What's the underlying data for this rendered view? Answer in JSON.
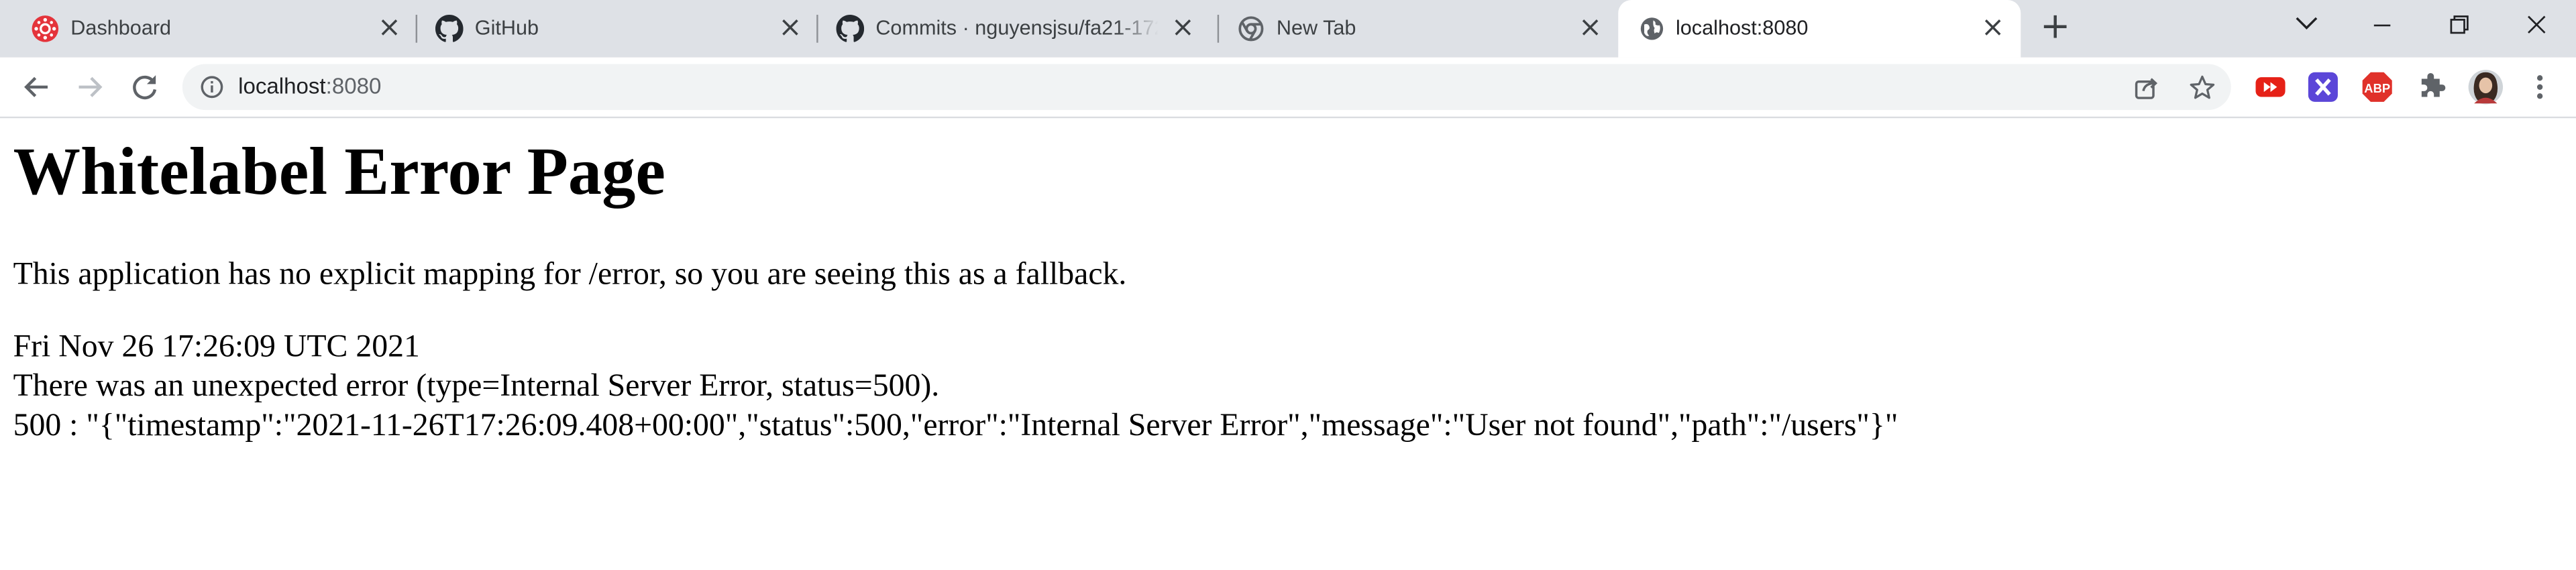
{
  "browser": {
    "tabs": [
      {
        "title": "Dashboard",
        "icon": "canvas-icon",
        "active": false
      },
      {
        "title": "GitHub",
        "icon": "github-icon",
        "active": false
      },
      {
        "title": "Commits · nguyensjsu/fa21-172-",
        "icon": "github-icon",
        "active": false
      },
      {
        "title": "New Tab",
        "icon": "chrome-icon",
        "active": false
      },
      {
        "title": "localhost:8080",
        "icon": "globe-icon",
        "active": true
      }
    ],
    "address": {
      "host": "localhost",
      "port": ":8080"
    },
    "colors": {
      "tabstrip": "#dee1e6",
      "omnibox": "#f1f3f4",
      "canvas_red": "#e4343b",
      "youtube_red": "#e62117",
      "ext_purple": "#5b46d8",
      "abp_red": "#e0312a"
    }
  },
  "page": {
    "heading": "Whitelabel Error Page",
    "description": "This application has no explicit mapping for /error, so you are seeing this as a fallback.",
    "timestamp": "Fri Nov 26 17:26:09 UTC 2021",
    "error_summary": "There was an unexpected error (type=Internal Server Error, status=500).",
    "error_detail": "500 : \"{\"timestamp\":\"2021-11-26T17:26:09.408+00:00\",\"status\":500,\"error\":\"Internal Server Error\",\"message\":\"User not found\",\"path\":\"/users\"}\""
  }
}
